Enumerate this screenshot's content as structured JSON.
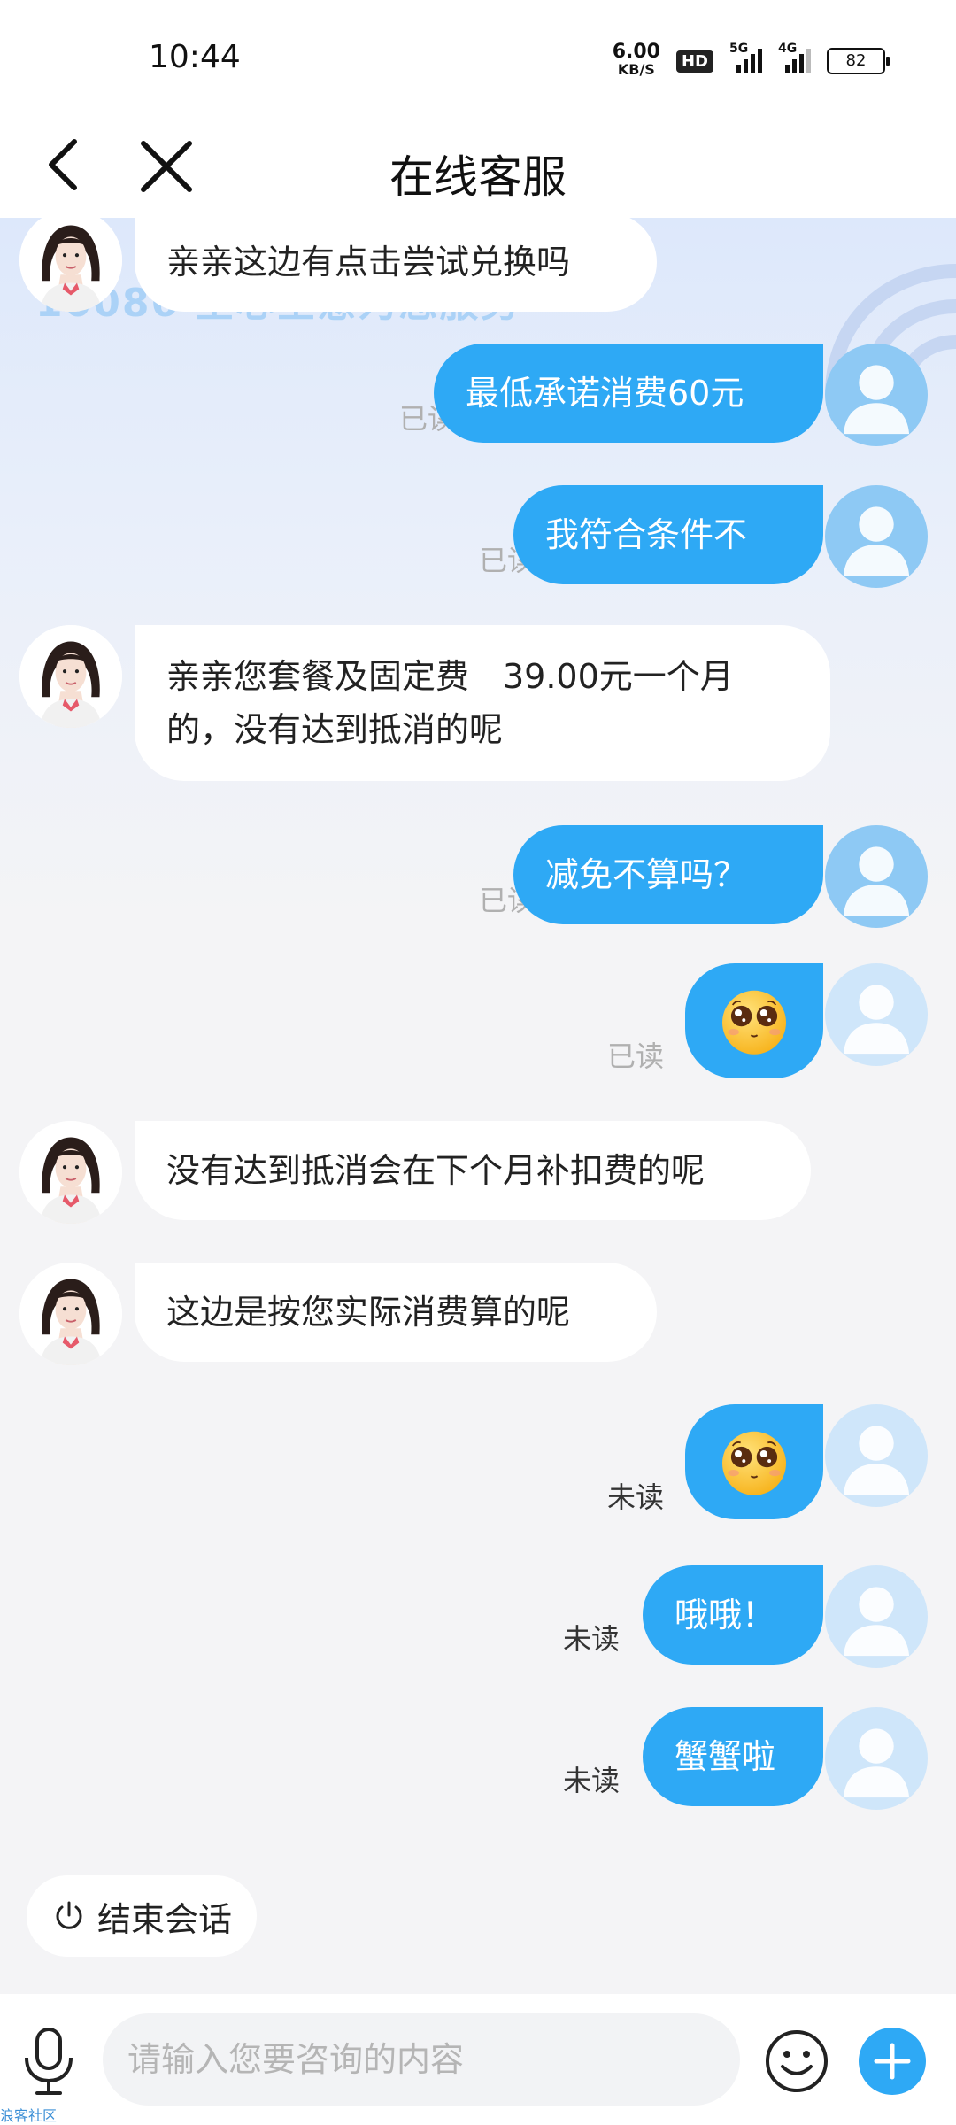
{
  "status_bar": {
    "time": "10:44",
    "net_speed": "6.00",
    "net_unit": "KB/S",
    "hd_label": "HD",
    "signal_1": "5G",
    "signal_2": "4G",
    "battery": "82"
  },
  "nav": {
    "title": "在线客服"
  },
  "background": {
    "watermark": "10086 全心全意为您服务"
  },
  "messages": [
    {
      "sender": "agent",
      "text": "亲亲这边有点击尝试兑换吗"
    },
    {
      "sender": "user",
      "text": "最低承诺消费60元",
      "status": "已读"
    },
    {
      "sender": "user",
      "text": "我符合条件不",
      "status": "已读"
    },
    {
      "sender": "agent",
      "text_line1": "亲亲您套餐及固定费　39.00元一个月",
      "text_line2": "的，没有达到抵消的呢"
    },
    {
      "sender": "user",
      "text": "减免不算吗？",
      "status": "已读"
    },
    {
      "sender": "user",
      "emoji": "smiling-face-emoji",
      "status": "已读"
    },
    {
      "sender": "agent",
      "text": "没有达到抵消会在下个月补扣费的呢"
    },
    {
      "sender": "agent",
      "text": "这边是按您实际消费算的呢"
    },
    {
      "sender": "user",
      "emoji": "smiling-face-emoji",
      "status": "未读"
    },
    {
      "sender": "user",
      "text": "哦哦！",
      "status": "未读"
    },
    {
      "sender": "user",
      "text": "蟹蟹啦",
      "status": "未读"
    }
  ],
  "end_session": {
    "label": "结束会话"
  },
  "input": {
    "placeholder": "请输入您要咨询的内容",
    "value": ""
  },
  "watermark_bottom": "浪客社区",
  "colors": {
    "accent": "#2ea9f5",
    "bubble_agent": "#ffffff",
    "read_text": "#b0b0b0",
    "unread_text": "#333333"
  }
}
